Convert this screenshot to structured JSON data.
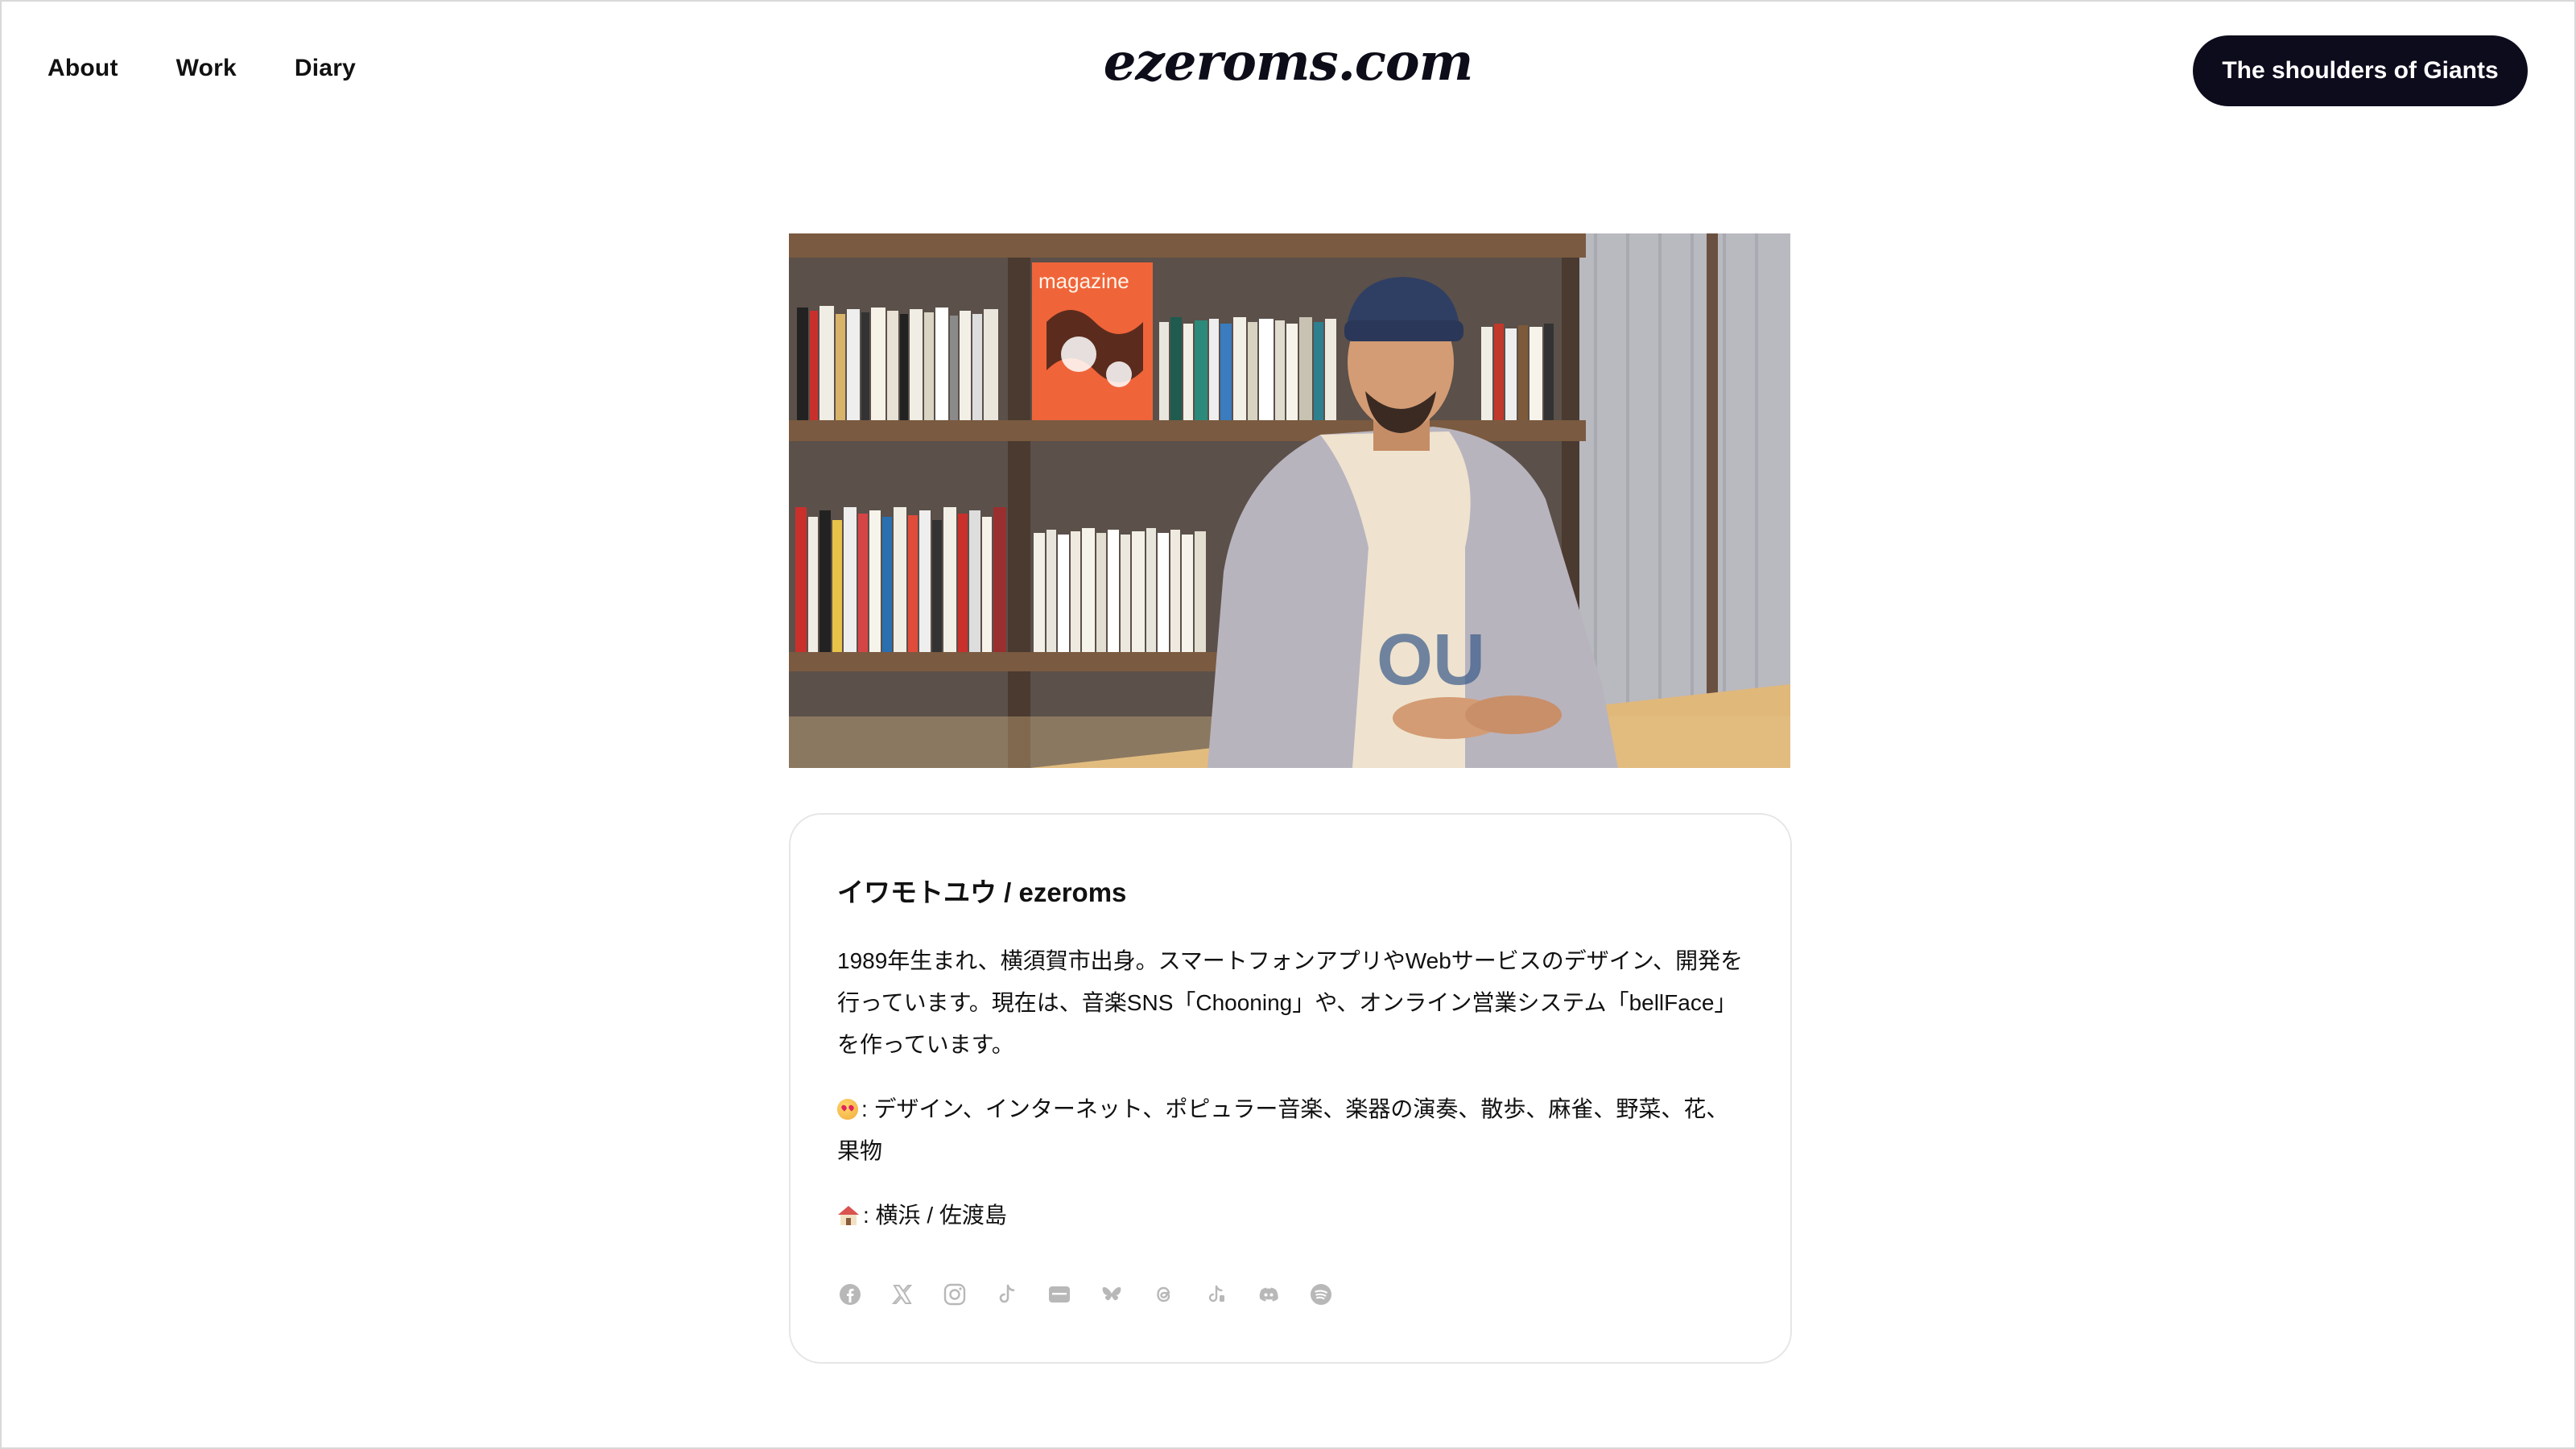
{
  "nav": {
    "items": [
      {
        "label": "About"
      },
      {
        "label": "Work"
      },
      {
        "label": "Diary"
      }
    ]
  },
  "site": {
    "logo": "ezeroms.com"
  },
  "header": {
    "cta_label": "The shoulders of Giants"
  },
  "hero": {
    "magazine_text": "magazine"
  },
  "profile": {
    "name": "イワモトユウ / ezeroms",
    "bio": "1989年生まれ、横須賀市出身。スマートフォンアプリやWebサービスのデザイン、開発を行っています。現在は、音楽SNS「Chooning」や、オンライン営業システム「bellFace」を作っています。",
    "likes": ": デザイン、インターネット、ポピュラー音楽、楽器の演奏、散歩、麻雀、野菜、花、果物",
    "home": ": 横浜 / 佐渡島"
  },
  "socials": [
    {
      "icon": "facebook-icon"
    },
    {
      "icon": "x-icon"
    },
    {
      "icon": "instagram-icon"
    },
    {
      "icon": "tiktok-icon"
    },
    {
      "icon": "note-icon"
    },
    {
      "icon": "bluesky-icon"
    },
    {
      "icon": "threads-icon"
    },
    {
      "icon": "tiktok-alt-icon"
    },
    {
      "icon": "discord-icon"
    },
    {
      "icon": "spotify-icon"
    }
  ],
  "colors": {
    "cta_background": "#0d0c1d",
    "icon_gray": "#b8b8b8",
    "card_border": "#e6e6e6"
  }
}
